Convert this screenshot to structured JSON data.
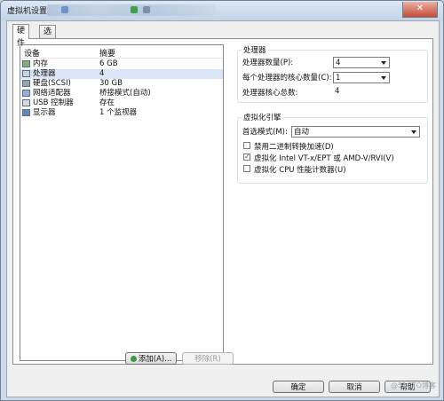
{
  "window": {
    "title": "虚拟机设置"
  },
  "tabs": [
    {
      "label": "硬件",
      "active": true
    },
    {
      "label": "选项",
      "active": false
    }
  ],
  "device_list": {
    "columns": [
      "设备",
      "摘要"
    ],
    "rows": [
      {
        "name": "内存",
        "summary": "6 GB",
        "icon": "memory-icon"
      },
      {
        "name": "处理器",
        "summary": "4",
        "icon": "processor-icon",
        "selected": true
      },
      {
        "name": "硬盘(SCSI)",
        "summary": "30 GB",
        "icon": "hard-disk-icon"
      },
      {
        "name": "网络适配器",
        "summary": "桥接模式(自动)",
        "icon": "network-adapter-icon"
      },
      {
        "name": "USB 控制器",
        "summary": "存在",
        "icon": "usb-controller-icon"
      },
      {
        "name": "显示器",
        "summary": "1 个监视器",
        "icon": "display-icon"
      }
    ]
  },
  "list_buttons": {
    "add": "添加(A)...",
    "remove": "移除(R)"
  },
  "processor": {
    "title": "处理器",
    "count_label": "处理器数量(P):",
    "count_value": "4",
    "cores_label": "每个处理器的核心数量(C):",
    "cores_value": "1",
    "total_label": "处理器核心总数:",
    "total_value": "4"
  },
  "virtualization": {
    "title": "虚拟化引擎",
    "mode_label": "首选模式(M):",
    "mode_value": "自动",
    "options": [
      {
        "label": "禁用二进制转换加速(D)",
        "checked": false
      },
      {
        "label": "虚拟化 Intel VT-x/EPT 或 AMD-V/RVI(V)",
        "checked": true
      },
      {
        "label": "虚拟化 CPU 性能计数器(U)",
        "checked": false
      }
    ]
  },
  "footer": {
    "ok": "确定",
    "cancel": "取消",
    "help": "帮助"
  },
  "watermark": "@51CTO博客"
}
